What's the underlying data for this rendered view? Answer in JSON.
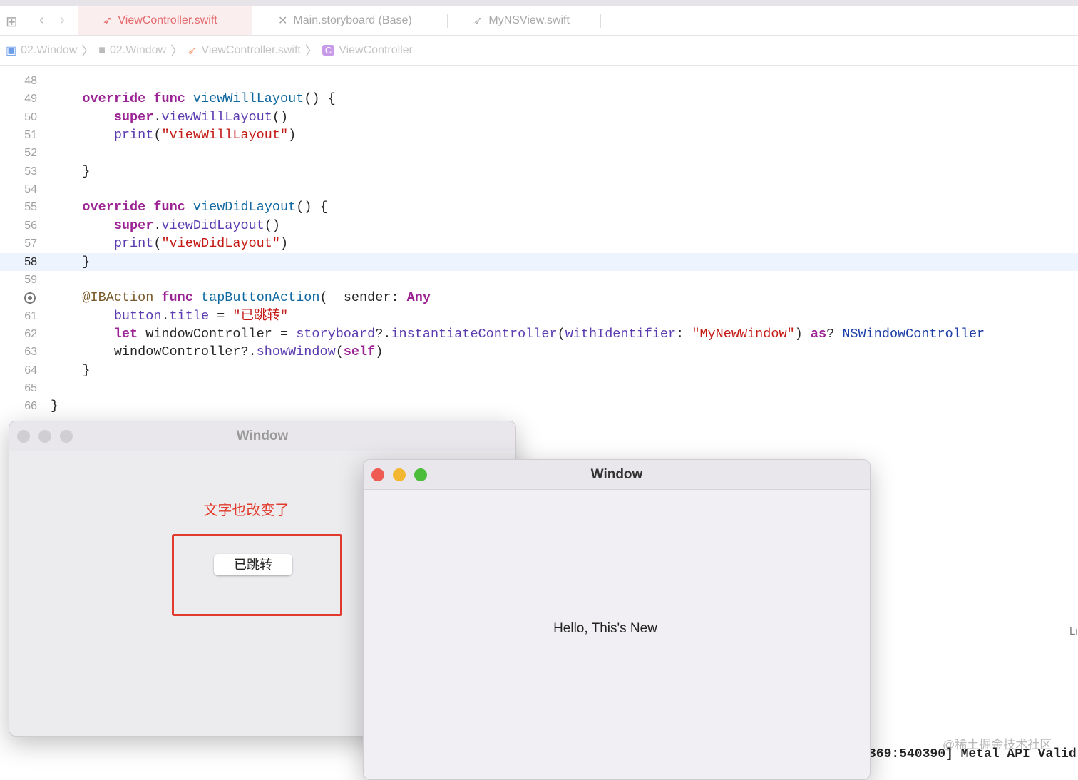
{
  "tabs": [
    {
      "label": "ViewController.swift",
      "icon": "swift-icon",
      "active": true
    },
    {
      "label": "Main.storyboard (Base)",
      "icon": "storyboard-icon"
    },
    {
      "label": "MyNSView.swift",
      "icon": "swift-icon"
    }
  ],
  "breadcrumb": [
    "02.Window",
    "02.Window",
    "ViewController.swift",
    "ViewController"
  ],
  "code": [
    {
      "n": "48",
      "t": []
    },
    {
      "n": "49",
      "t": [
        [
          "",
          "    "
        ],
        [
          "kw",
          "override"
        ],
        [
          "",
          " "
        ],
        [
          "kw",
          "func"
        ],
        [
          "",
          " "
        ],
        [
          "fn",
          "viewWillLayout"
        ],
        [
          "",
          "() {"
        ]
      ]
    },
    {
      "n": "50",
      "t": [
        [
          "",
          "        "
        ],
        [
          "kw",
          "super"
        ],
        [
          "",
          "."
        ],
        [
          "call",
          "viewWillLayout"
        ],
        [
          "",
          "()"
        ]
      ]
    },
    {
      "n": "51",
      "t": [
        [
          "",
          "        "
        ],
        [
          "call",
          "print"
        ],
        [
          "",
          "("
        ],
        [
          "str",
          "\"viewWillLayout\""
        ],
        [
          "",
          ")"
        ]
      ]
    },
    {
      "n": "52",
      "t": []
    },
    {
      "n": "53",
      "t": [
        [
          "",
          "    }"
        ]
      ]
    },
    {
      "n": "54",
      "t": []
    },
    {
      "n": "55",
      "t": [
        [
          "",
          "    "
        ],
        [
          "kw",
          "override"
        ],
        [
          "",
          " "
        ],
        [
          "kw",
          "func"
        ],
        [
          "",
          " "
        ],
        [
          "fn",
          "viewDidLayout"
        ],
        [
          "",
          "() {"
        ]
      ]
    },
    {
      "n": "56",
      "t": [
        [
          "",
          "        "
        ],
        [
          "kw",
          "super"
        ],
        [
          "",
          "."
        ],
        [
          "call",
          "viewDidLayout"
        ],
        [
          "",
          "()"
        ]
      ]
    },
    {
      "n": "57",
      "t": [
        [
          "",
          "        "
        ],
        [
          "call",
          "print"
        ],
        [
          "",
          "("
        ],
        [
          "str",
          "\"viewDidLayout\""
        ],
        [
          "",
          ")"
        ]
      ]
    },
    {
      "n": "58",
      "t": [
        [
          "",
          "    }"
        ]
      ],
      "current": true
    },
    {
      "n": "59",
      "t": []
    },
    {
      "n": "",
      "breakpoint": true,
      "t": [
        [
          "",
          "    "
        ],
        [
          "attr",
          "@IBAction"
        ],
        [
          "",
          " "
        ],
        [
          "kw",
          "func"
        ],
        [
          "",
          " "
        ],
        [
          "fn",
          "tapButtonAction"
        ],
        [
          "",
          "(_ sender: "
        ],
        [
          "kw",
          "Any"
        ],
        [
          ") {"
        ]
      ]
    },
    {
      "n": "61",
      "t": [
        [
          "",
          "        "
        ],
        [
          "call",
          "button"
        ],
        [
          "",
          "."
        ],
        [
          "call",
          "title"
        ],
        [
          "",
          " = "
        ],
        [
          "str",
          "\"已跳转\""
        ]
      ]
    },
    {
      "n": "62",
      "t": [
        [
          "",
          "        "
        ],
        [
          "kw",
          "let"
        ],
        [
          "",
          " windowController = "
        ],
        [
          "call",
          "storyboard"
        ],
        [
          "",
          "?."
        ],
        [
          "call",
          "instantiateController"
        ],
        [
          "",
          "("
        ],
        [
          "call",
          "withIdentifier"
        ],
        [
          "",
          ": "
        ],
        [
          "str",
          "\"MyNewWindow\""
        ],
        [
          "",
          ") "
        ],
        [
          "kw",
          "as"
        ],
        [
          "",
          "? "
        ],
        [
          "ty",
          "NSWindowController"
        ]
      ]
    },
    {
      "n": "63",
      "t": [
        [
          "",
          "        windowController?."
        ],
        [
          "call",
          "showWindow"
        ],
        [
          "",
          "("
        ],
        [
          "kw",
          "self"
        ],
        [
          "",
          ")"
        ]
      ]
    },
    {
      "n": "64",
      "t": [
        [
          "",
          "    }"
        ]
      ]
    },
    {
      "n": "65",
      "t": []
    },
    {
      "n": "66",
      "t": [
        [
          "",
          "}"
        ]
      ]
    }
  ],
  "window1": {
    "title": "Window",
    "label": "文字也改变了",
    "button": "已跳转"
  },
  "window2": {
    "title": "Window",
    "text": "Hello, This's New"
  },
  "debug": {
    "partial_label": "Li",
    "console": "369:540390] Metal API Valid"
  },
  "watermark": "@稀土掘金技术社区"
}
